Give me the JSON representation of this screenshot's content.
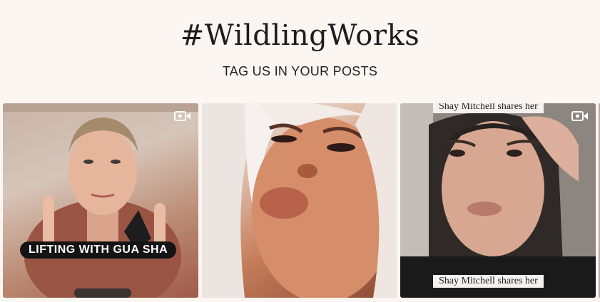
{
  "header": {
    "title": "#WildlingWorks",
    "subtitle": "TAG US IN YOUR POSTS"
  },
  "posts": [
    {
      "type": "video",
      "icon": "video-camera-icon",
      "caption": "LIFTING WITH GUA SHA"
    },
    {
      "type": "image"
    },
    {
      "type": "video",
      "icon": "video-camera-icon",
      "caption_top": "Shay Mitchell shares her",
      "caption_bottom": "Shay Mitchell shares her"
    }
  ],
  "colors": {
    "background": "#fcf6f2",
    "text": "#1d1d1f"
  }
}
